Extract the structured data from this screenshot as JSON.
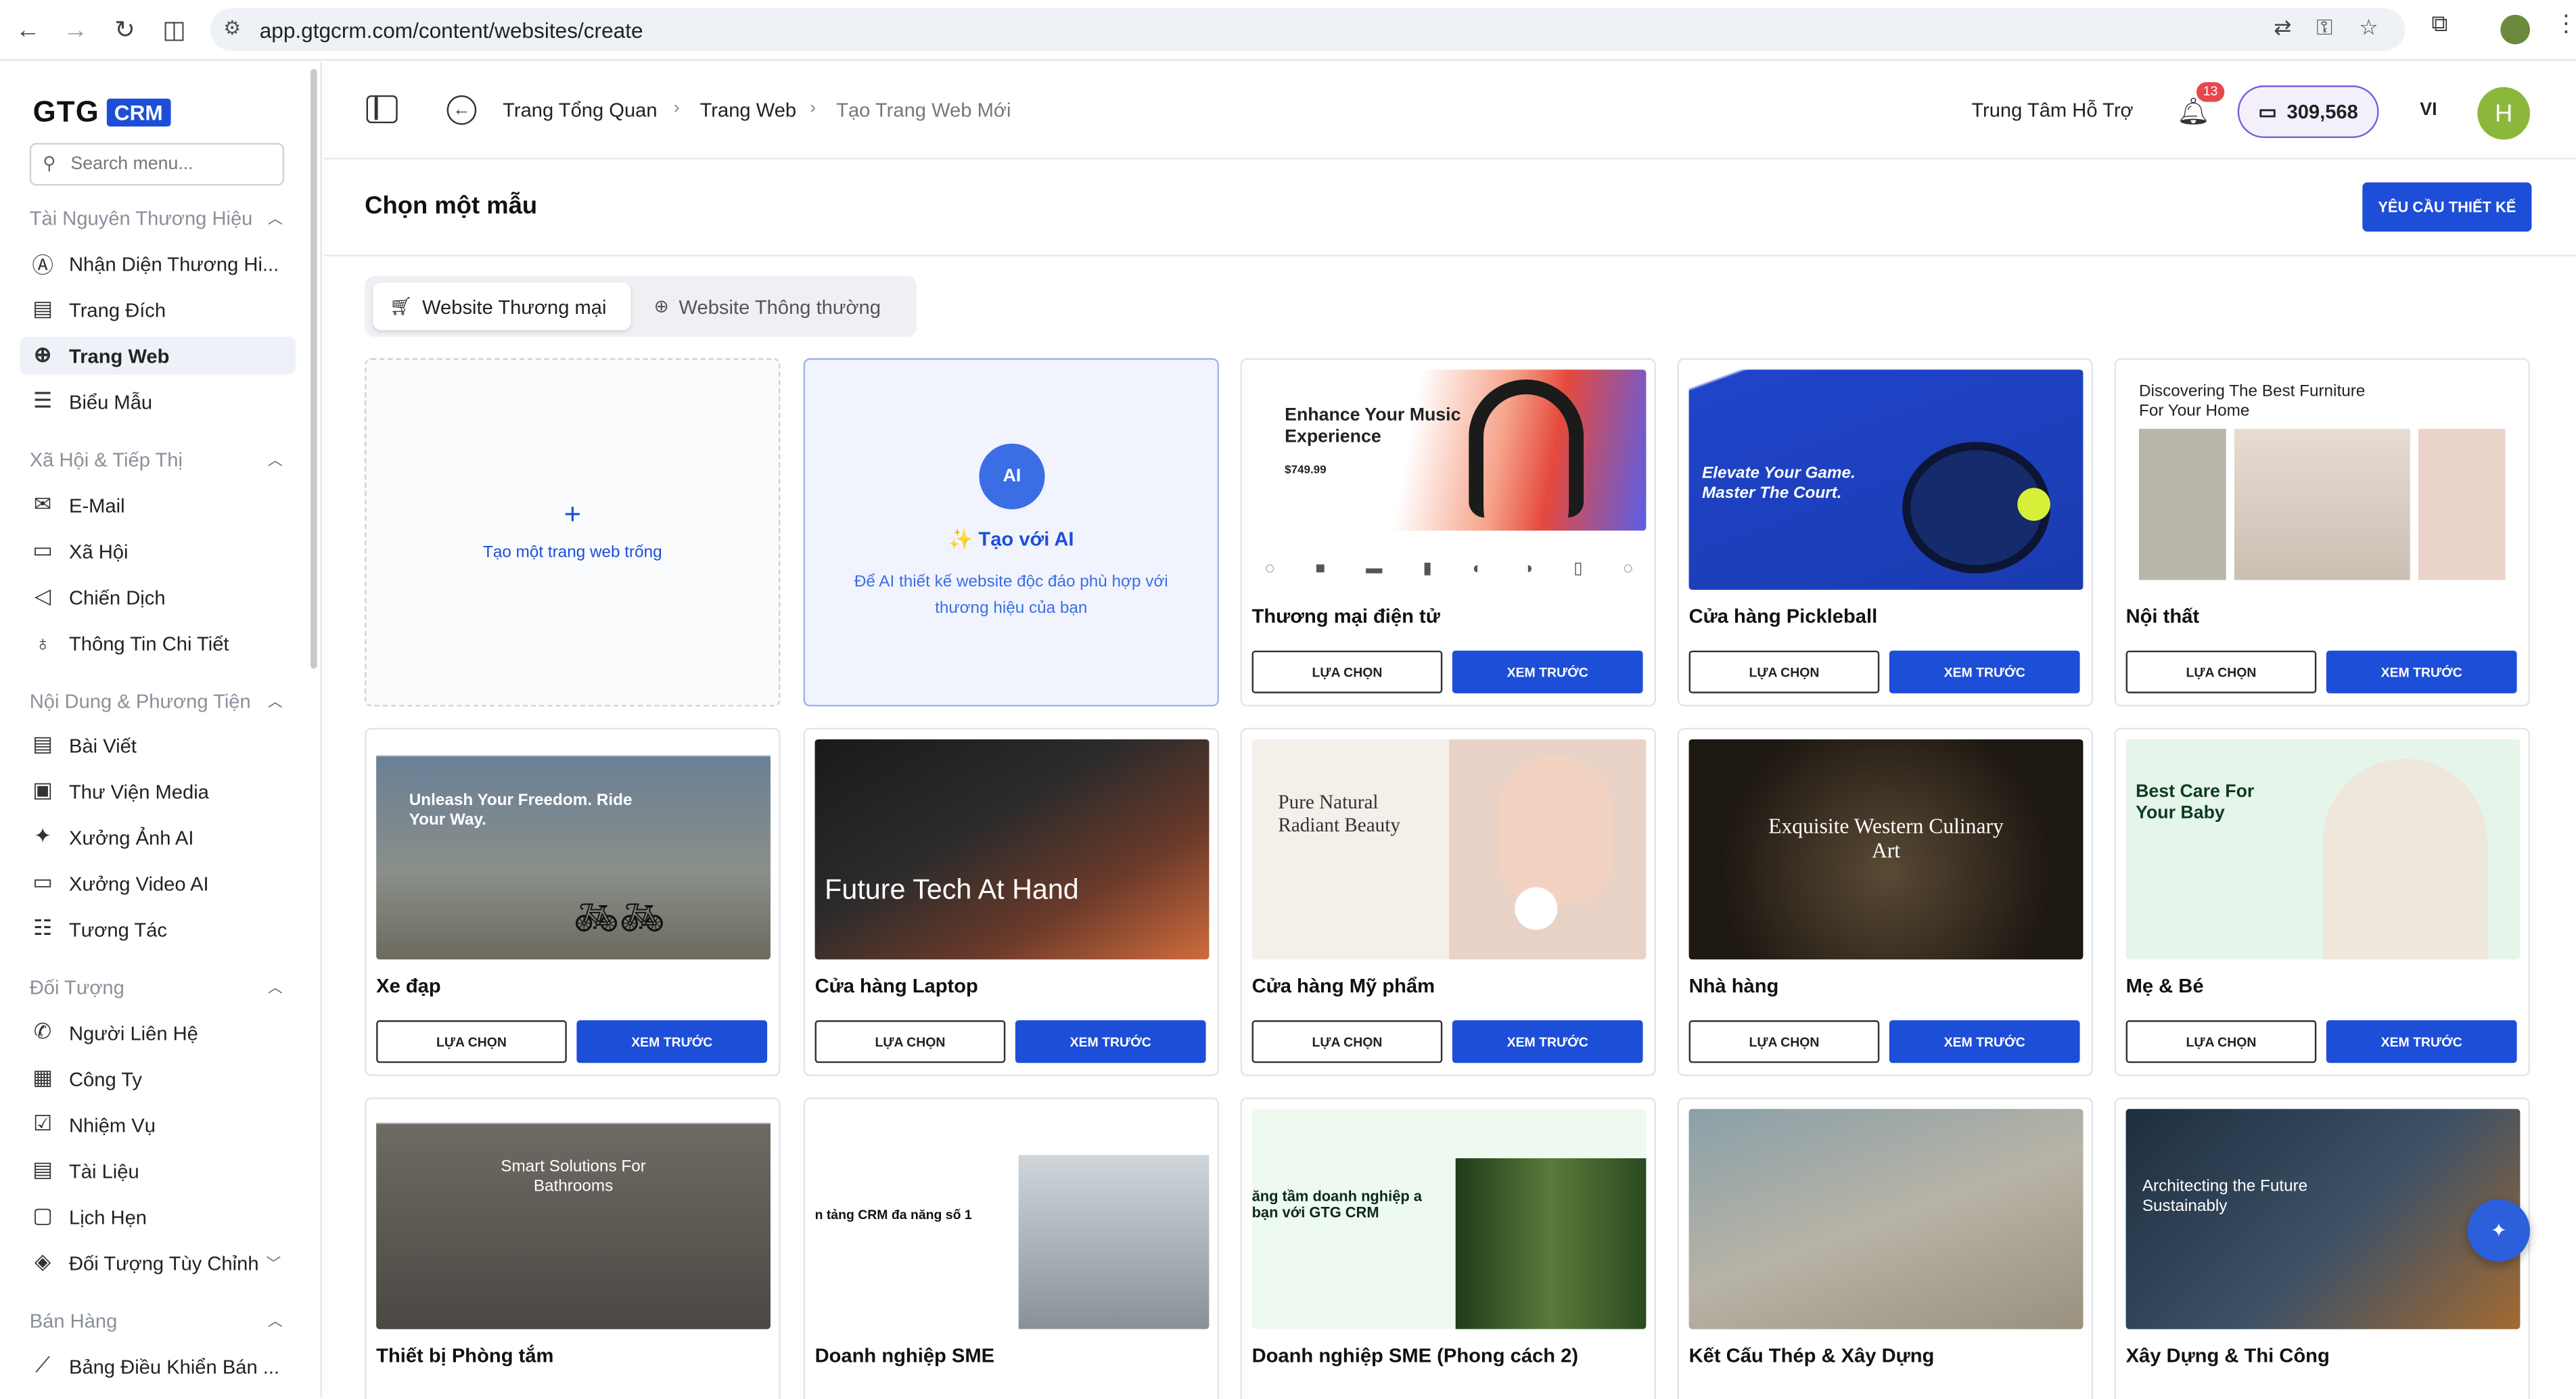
{
  "browser": {
    "url": "app.gtgcrm.com/content/websites/create"
  },
  "brand": {
    "name": "GTG",
    "badge": "CRM"
  },
  "sidebar": {
    "search_placeholder": "Search menu...",
    "sections": [
      {
        "title": "Tài Nguyên Thương Hiệu",
        "items": [
          "Nhận Diện Thương Hi...",
          "Trang Đích",
          "Trang Web",
          "Biểu Mẫu"
        ]
      },
      {
        "title": "Xã Hội & Tiếp Thị",
        "items": [
          "E-Mail",
          "Xã Hội",
          "Chiến Dịch",
          "Thông Tin Chi Tiết"
        ]
      },
      {
        "title": "Nội Dung & Phương Tiện",
        "items": [
          "Bài Viết",
          "Thư Viện Media",
          "Xưởng Ảnh AI",
          "Xưởng Video AI",
          "Tương Tác"
        ]
      },
      {
        "title": "Đối Tượng",
        "items": [
          "Người Liên Hệ",
          "Công Ty",
          "Nhiệm Vụ",
          "Tài Liệu",
          "Lịch Hẹn",
          "Đối Tượng Tùy Chỉnh"
        ]
      },
      {
        "title": "Bán Hàng",
        "items": [
          "Bảng Điều Khiển Bán ..."
        ]
      }
    ]
  },
  "header": {
    "breadcrumbs": [
      "Trang Tổng Quan",
      "Trang Web",
      "Tạo Trang Web Mới"
    ],
    "support": "Trung Tâm Hỗ Trợ",
    "notifications": "13",
    "credits": "309,568",
    "lang": "VI",
    "avatar": "H"
  },
  "page": {
    "title": "Chọn một mẫu",
    "request_button": "YÊU CẦU THIẾT KẾ",
    "tabs": [
      "Website Thương mại",
      "Website Thông thường"
    ]
  },
  "blank_card": {
    "plus": "+",
    "label": "Tạo một trang web trống"
  },
  "ai_card": {
    "icon": "AI",
    "title": "✨ Tạo với AI",
    "desc": "Để AI thiết kế website độc đáo phù hợp với thương hiệu của bạn"
  },
  "buttons": {
    "select": "LỰA CHỌN",
    "preview": "XEM TRƯỚC"
  },
  "templates": [
    {
      "name": "Thương mại điện tử",
      "hero": "Enhance Your Music Experience",
      "price": "$749.99"
    },
    {
      "name": "Cửa hàng Pickleball",
      "hero": "Elevate Your Game. Master The Court."
    },
    {
      "name": "Nội thất",
      "hero": "Discovering The Best Furniture For Your Home"
    },
    {
      "name": "Xe đạp",
      "hero": "Unleash Your Freedom. Ride Your Way."
    },
    {
      "name": "Cửa hàng Laptop",
      "hero": "Future Tech At Hand"
    },
    {
      "name": "Cửa hàng Mỹ phẩm",
      "hero": "Pure Natural Radiant Beauty"
    },
    {
      "name": "Nhà hàng",
      "hero": "Exquisite Western Culinary Art"
    },
    {
      "name": "Mẹ & Bé",
      "hero": "Best Care For Your Baby"
    },
    {
      "name": "Thiết bị Phòng tắm",
      "hero": "Smart Solutions For Bathrooms"
    },
    {
      "name": "Doanh nghiệp SME",
      "hero": "n tảng CRM đa năng số 1"
    },
    {
      "name": "Doanh nghiệp SME (Phong cách 2)",
      "hero": "ăng tầm doanh nghiệp a bạn với GTG CRM"
    },
    {
      "name": "Kết Cấu Thép & Xây Dựng",
      "hero": ""
    },
    {
      "name": "Xây Dựng & Thi Công",
      "hero": "Architecting the Future Sustainably"
    }
  ]
}
